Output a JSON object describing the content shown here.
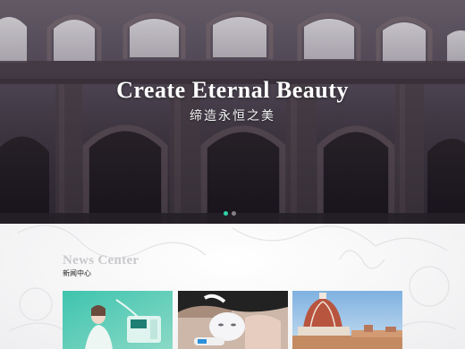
{
  "hero": {
    "title": "Create Eternal Beauty",
    "subtitle": "缔造永恒之美",
    "slides": 2,
    "active_slide": 1
  },
  "news": {
    "heading": "News Center",
    "subheading": "新闻中心",
    "cards": [
      {
        "image": "beauty-treatment-machine-photo"
      },
      {
        "image": "facial-mask-treatment-photo"
      },
      {
        "image": "florence-cathedral-dome-photo"
      }
    ]
  },
  "colors": {
    "accent": "#2fd3a8",
    "hero_stone": "#5b5360",
    "card_teal": "#4fc9b4"
  }
}
